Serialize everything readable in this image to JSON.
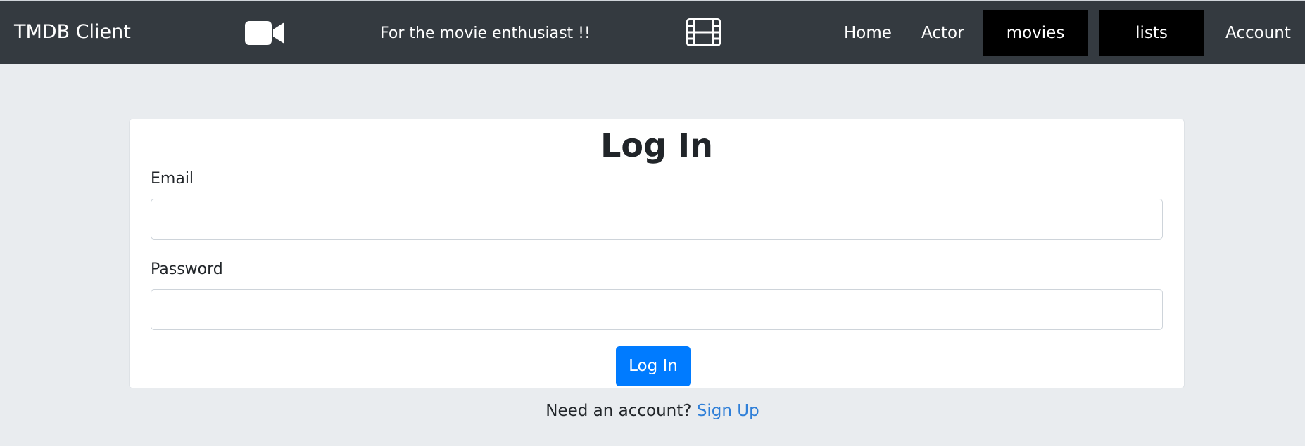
{
  "navbar": {
    "brand": "TMDB Client",
    "tagline": "For the movie enthusiast !!",
    "icons": {
      "left": "video-camera-icon",
      "right": "film-strip-icon"
    },
    "links": {
      "home": "Home",
      "actor": "Actor",
      "movies": "movies",
      "lists": "lists",
      "account": "Account"
    }
  },
  "login": {
    "title": "Log In",
    "email_label": "Email",
    "email_value": "",
    "password_label": "Password",
    "password_value": "",
    "submit_label": "Log In"
  },
  "footer": {
    "prompt": "Need an account?",
    "signup_link": "Sign Up"
  },
  "colors": {
    "navbar_bg": "#343a40",
    "page_bg": "#e9ecef",
    "primary": "#007bff",
    "nav_button_bg": "#000000",
    "link": "#2f7fd8"
  }
}
